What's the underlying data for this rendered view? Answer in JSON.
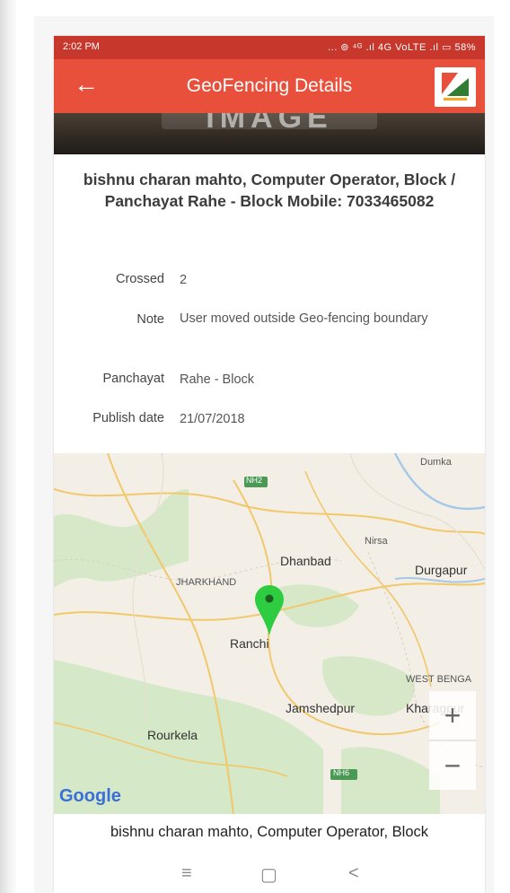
{
  "status_bar": {
    "time": "2:02 PM",
    "icons": "... ⊚ ⁴ᴳ .ıl 4G VoLTE .ıl ▭ 58%"
  },
  "app_bar": {
    "back_glyph": "←",
    "title": "GeoFencing Details"
  },
  "banner_text": "IMAGE",
  "heading": "bishnu charan mahto, Computer Operator, Block / Panchayat Rahe - Block Mobile: 7033465082",
  "fields": [
    {
      "label": "Crossed",
      "value": "2"
    },
    {
      "label": "Note",
      "value": "User moved outside Geo-fencing boundary"
    },
    {
      "label": "Panchayat",
      "value": "Rahe - Block"
    },
    {
      "label": "Publish date",
      "value": "21/07/2018"
    }
  ],
  "map": {
    "labels": {
      "dumka": "Dumka",
      "nh": "NH2",
      "nirsa": "Nirsa",
      "dhanbad": "Dhanbad",
      "durgapur": "Durgapur",
      "jharkhand": "JHARKHAND",
      "ranchi": "Ranchi",
      "west_bengal": "WEST BENGA",
      "jamshedpur": "Jamshedpur",
      "kharagpur": "Kharagpur",
      "rourkela": "Rourkela",
      "nh_south": "NH6",
      "google": "Google"
    },
    "zoom_in": "+",
    "zoom_out": "−"
  },
  "footer_text": "bishnu charan mahto, Computer Operator, Block",
  "nav": {
    "menu": "≡",
    "home": "▢",
    "back": "<"
  },
  "colors": {
    "status_bar": "#c8372b",
    "app_bar": "#e8503c",
    "pin": "#2ecc40"
  }
}
